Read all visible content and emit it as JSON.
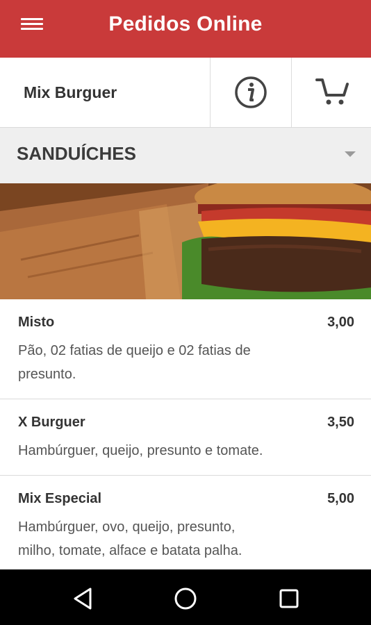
{
  "app_bar": {
    "title": "Pedidos Online",
    "menu_icon": "hamburger-menu-icon"
  },
  "store_bar": {
    "store_name": "Mix Burguer",
    "info_icon": "info-icon",
    "cart_icon": "cart-icon"
  },
  "category": {
    "label": "SANDUÍCHES",
    "dropdown_icon": "chevron-down-icon"
  },
  "menu_items": [
    {
      "name": "Misto",
      "price": "3,00",
      "desc_line1": "Pão, 02 fatias de queijo e 02 fatias de",
      "desc_line2": "presunto."
    },
    {
      "name": "X Burguer",
      "price": "3,50",
      "desc_line1": "Hambúrguer, queijo, presunto e tomate.",
      "desc_line2": ""
    },
    {
      "name": "Mix Especial",
      "price": "5,00",
      "desc_line1": "Hambúrguer, ovo, queijo, presunto,",
      "desc_line2": "milho, tomate, alface e batata palha."
    }
  ],
  "nav_bar": {
    "back_icon": "back-triangle-icon",
    "home_icon": "home-circle-icon",
    "recents_icon": "recents-square-icon"
  },
  "colors": {
    "primary": "#c93a3a",
    "category_bg": "#efefef",
    "nav_bg": "#000000"
  }
}
